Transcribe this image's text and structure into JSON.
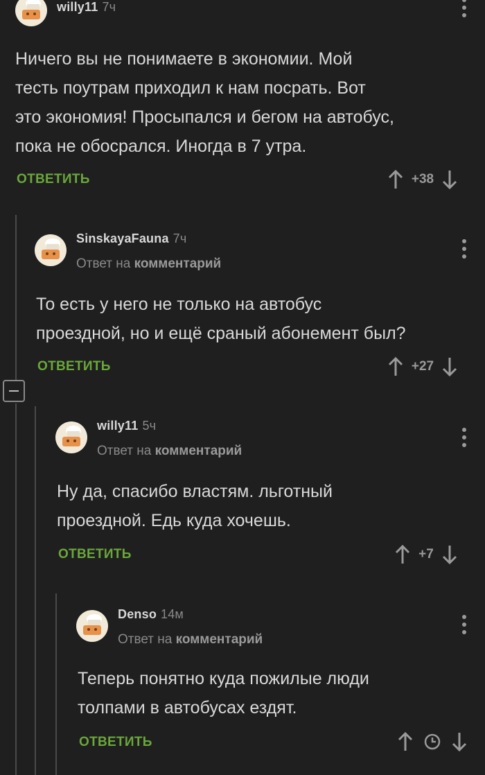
{
  "comments": [
    {
      "author": "willy11",
      "time": "7ч",
      "reply_prefix": "",
      "reply_link": "",
      "text_lines": [
        "Ничего вы не понимаете в экономии. Мой",
        "тесть поутрам приходил к нам посрать. Вот",
        "это экономия! Просыпался и бегом на автобус,",
        "пока не обосрался. Иногда в 7 утра."
      ],
      "reply_label": "ОТВЕТИТЬ",
      "rating": "+38"
    },
    {
      "author": "SinskayaFauna",
      "time": "7ч",
      "reply_prefix": "Ответ на",
      "reply_link": "комментарий",
      "text_lines": [
        "То есть у него не только на автобус",
        "проездной, но и ещё сраный абонемент был?"
      ],
      "reply_label": "ОТВЕТИТЬ",
      "rating": "+27"
    },
    {
      "author": "willy11",
      "time": "5ч",
      "reply_prefix": "Ответ на",
      "reply_link": "комментарий",
      "text_lines": [
        "Ну да, спасибо властям. льготный",
        "проездной. Едь куда хочешь."
      ],
      "reply_label": "ОТВЕТИТЬ",
      "rating": "+7"
    },
    {
      "author": "Denso",
      "time": "14м",
      "reply_prefix": "Ответ на",
      "reply_link": "комментарий",
      "text_lines": [
        "Теперь понятно куда пожилые люди",
        "толпами в автобусах ездят."
      ],
      "reply_label": "ОТВЕТИТЬ",
      "rating_icon": "clock-icon"
    }
  ],
  "colors": {
    "background": "#1f1f1f",
    "text": "#d9d9d9",
    "muted": "#8a8a8a",
    "reply_action": "#6aa83a",
    "avatar_bg": "#f2ead8"
  },
  "icons": [
    "avatar-chef-icon",
    "kebab-menu-icon",
    "arrow-up-icon",
    "arrow-down-icon",
    "clock-icon",
    "collapse-icon"
  ]
}
